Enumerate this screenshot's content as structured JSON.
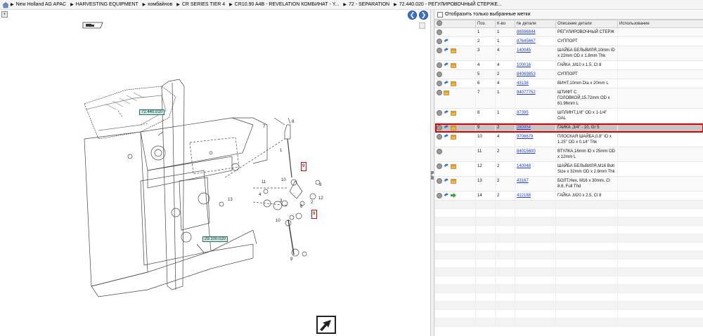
{
  "breadcrumb": [
    "New Holland AG APAC",
    "HARVESTING EQUIPMENT",
    "комбайнов",
    "CR SERIES TIER 4",
    "CR10.90 A4B - REVELATION КОМБИНАТ - Y...",
    "72 - SEPARATION",
    "72.440.020 - РЕГУЛИРОВОЧНЫЙ СТЕРЖЕ..."
  ],
  "diagram": {
    "callouts": [
      "72.440.010",
      "29.100.020"
    ],
    "numbers": [
      "7",
      "8",
      "1",
      "11",
      "10",
      "9",
      "4",
      "12",
      "3",
      "13",
      "6",
      "2",
      "10",
      "9",
      "5",
      "14"
    ]
  },
  "parts": {
    "filter_label": "Отобразить только выбранные метки",
    "headers": [
      "Поз.",
      "К-во",
      "№ детали",
      "Описание детали",
      "Использование"
    ],
    "rows": [
      {
        "pos": "1",
        "qty": "1",
        "part": "86596844",
        "desc": "РЕГУЛИРОВОЧНЫЙ СТЕРЖ",
        "icons": "c"
      },
      {
        "pos": "2",
        "qty": "1",
        "part": "87645667",
        "desc": "СУППОРТ",
        "icons": "cb"
      },
      {
        "pos": "3",
        "qty": "4",
        "part": "140045",
        "desc": "ШАЙБА БЕЛЬВИЛЯ,10mm ID x 22mm OD x 1.8mm Thk",
        "icons": "cbx"
      },
      {
        "pos": "4",
        "qty": "4",
        "part": "100016",
        "desc": "ГАЙКА ,M10 x 1.5, Cl 8",
        "icons": "cbx"
      },
      {
        "pos": "5",
        "qty": "2",
        "part": "84069853",
        "desc": "СУППОРТ",
        "icons": "c"
      },
      {
        "pos": "6",
        "qty": "4",
        "part": "43138",
        "desc": "ВИНТ,10mm Dia x 20mm L",
        "icons": "cbx"
      },
      {
        "pos": "7",
        "qty": "1",
        "part": "84077752",
        "desc": "ШТИФТ С ГОЛОВКОЙ,15.72mm OD x 61.96mm L",
        "icons": "cx"
      },
      {
        "pos": "8",
        "qty": "1",
        "part": "87395",
        "desc": "ШПЛИНТ,1/8\" OD x 1-1/4\" OAL",
        "icons": "cbx"
      },
      {
        "pos": "9",
        "qty": "2",
        "part": "280954",
        "desc": "ГАЙКА ,3/4\" - 10, Gr 5",
        "icons": "cbx",
        "selected": true
      },
      {
        "pos": "10",
        "qty": "4",
        "part": "9706679",
        "desc": "ПЛОСКАЯ ШАЙБА,0.8\" ID x 1.25\" OD x 0.14\" Thk",
        "icons": "cbx"
      },
      {
        "pos": "11",
        "qty": "2",
        "part": "84015600",
        "desc": "ВТУЛКА,16mm ID x 25mm OD x 12mm L",
        "icons": "c"
      },
      {
        "pos": "12",
        "qty": "2",
        "part": "140048",
        "desc": "ШАЙБА БЕЛЬВИЛЯ,M16 Bolt Size x 32mm OD x 2.8mm Thk",
        "icons": "cbx"
      },
      {
        "pos": "13",
        "qty": "2",
        "part": "43167",
        "desc": "БОЛТ,Hex, M16 x 30mm, Cl 8.8, Full Thd",
        "icons": "cbx"
      },
      {
        "pos": "14",
        "qty": "2",
        "part": "412188",
        "desc": "ГАЙКА ,M20 x 2.5, Cl 8",
        "icons": "cbg"
      }
    ]
  },
  "colors": {
    "selected_outline": "#dd0000",
    "link": "#1a3fcc",
    "nav_button": "#3a73c7"
  }
}
